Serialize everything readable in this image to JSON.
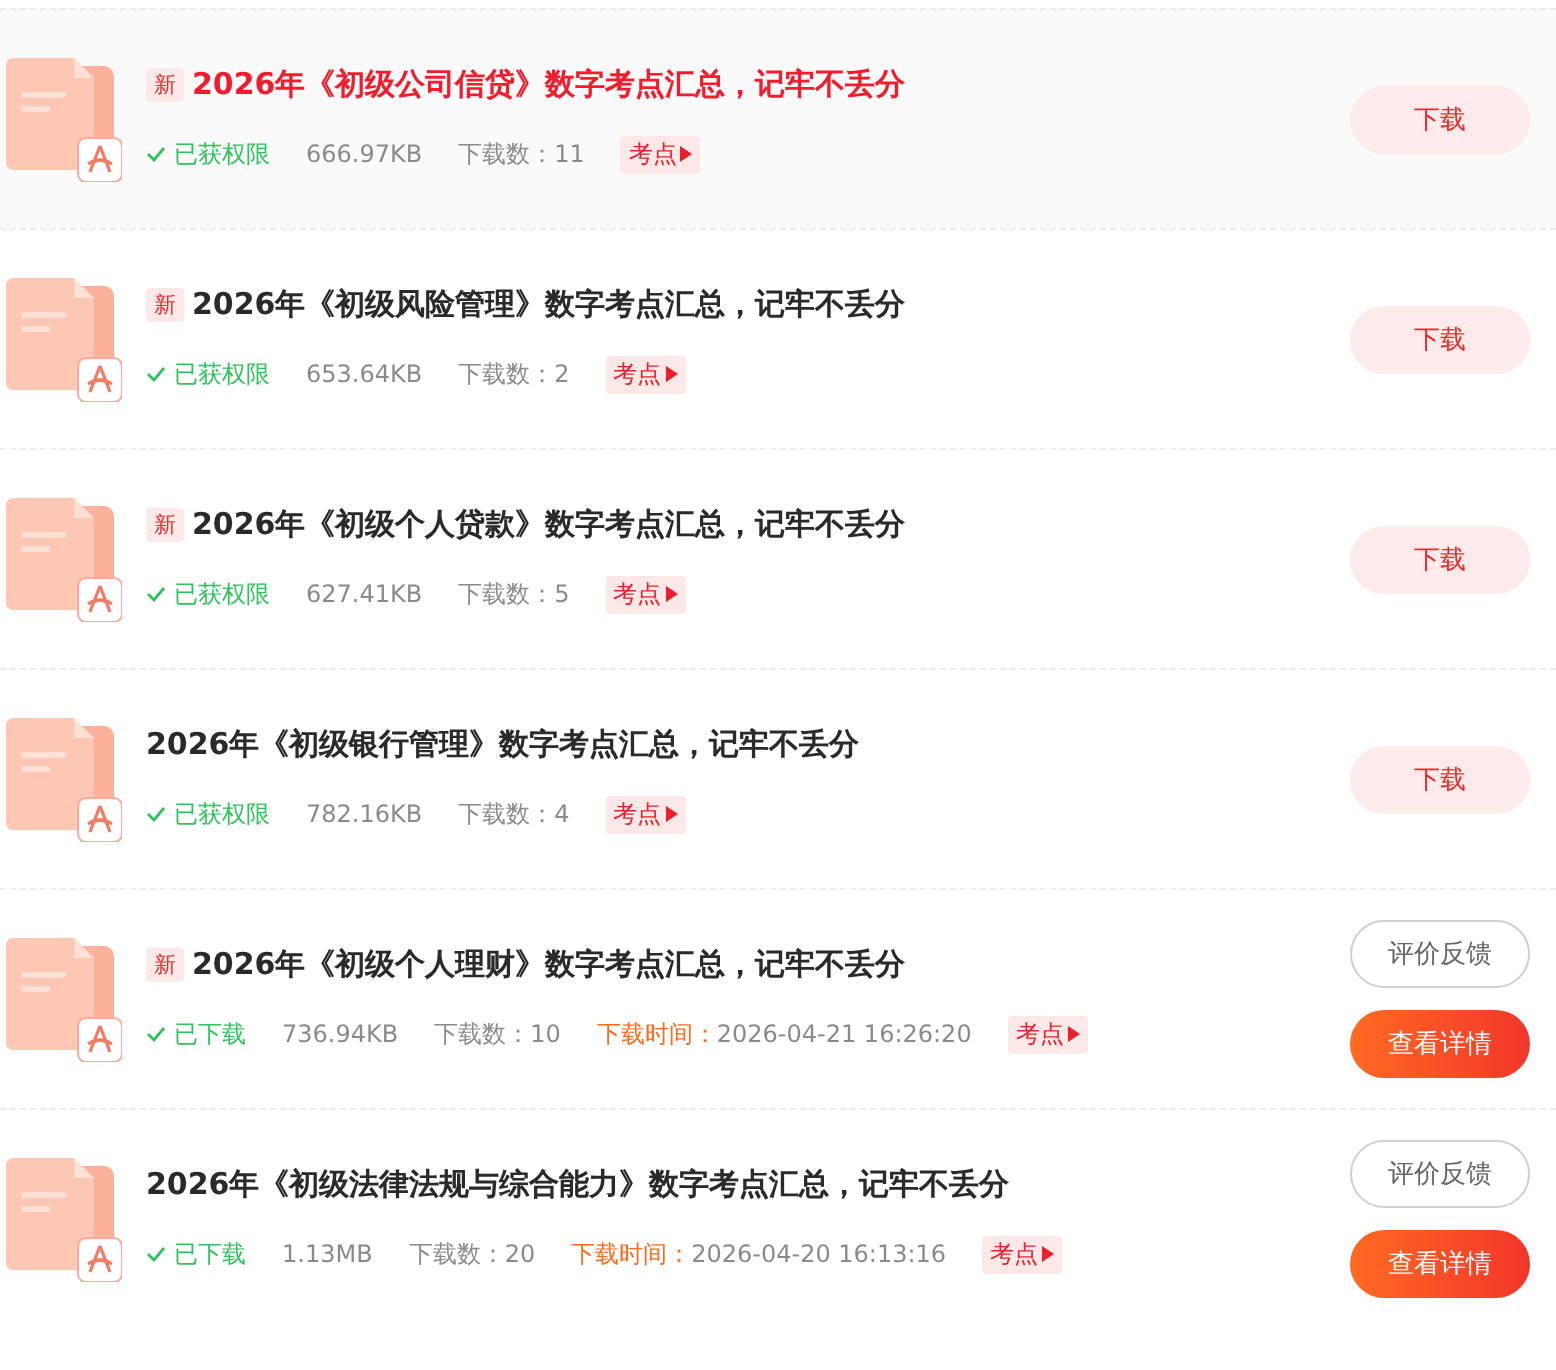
{
  "rows": [
    {
      "selected": true,
      "new": true,
      "new_label": "新",
      "title": "2026年《初级公司信贷》数字考点汇总，记牢不丢分",
      "status": "已获权限",
      "size": "666.97KB",
      "downloads": "下载数：11",
      "tag": "考点",
      "actions": [
        {
          "kind": "soft",
          "label": "下载"
        }
      ]
    },
    {
      "selected": false,
      "new": true,
      "new_label": "新",
      "title": "2026年《初级风险管理》数字考点汇总，记牢不丢分",
      "status": "已获权限",
      "size": "653.64KB",
      "downloads": "下载数：2",
      "tag": "考点",
      "actions": [
        {
          "kind": "soft",
          "label": "下载"
        }
      ]
    },
    {
      "selected": false,
      "new": true,
      "new_label": "新",
      "title": "2026年《初级个人贷款》数字考点汇总，记牢不丢分",
      "status": "已获权限",
      "size": "627.41KB",
      "downloads": "下载数：5",
      "tag": "考点",
      "actions": [
        {
          "kind": "soft",
          "label": "下载"
        }
      ]
    },
    {
      "selected": false,
      "new": false,
      "title": "2026年《初级银行管理》数字考点汇总，记牢不丢分",
      "status": "已获权限",
      "size": "782.16KB",
      "downloads": "下载数：4",
      "tag": "考点",
      "actions": [
        {
          "kind": "soft",
          "label": "下载"
        }
      ]
    },
    {
      "selected": false,
      "new": true,
      "new_label": "新",
      "title": "2026年《初级个人理财》数字考点汇总，记牢不丢分",
      "status": "已下载",
      "size": "736.94KB",
      "downloads": "下载数：10",
      "time_label": "下载时间：",
      "time": "2026-04-21 16:26:20",
      "tag": "考点",
      "actions": [
        {
          "kind": "outline",
          "label": "评价反馈"
        },
        {
          "kind": "primary",
          "label": "查看详情"
        }
      ]
    },
    {
      "selected": false,
      "new": false,
      "title": "2026年《初级法律法规与综合能力》数字考点汇总，记牢不丢分",
      "status": "已下载",
      "size": "1.13MB",
      "downloads": "下载数：20",
      "time_label": "下载时间：",
      "time": "2026-04-20 16:13:16",
      "tag": "考点",
      "actions": [
        {
          "kind": "outline",
          "label": "评价反馈"
        },
        {
          "kind": "primary",
          "label": "查看详情"
        }
      ]
    }
  ]
}
